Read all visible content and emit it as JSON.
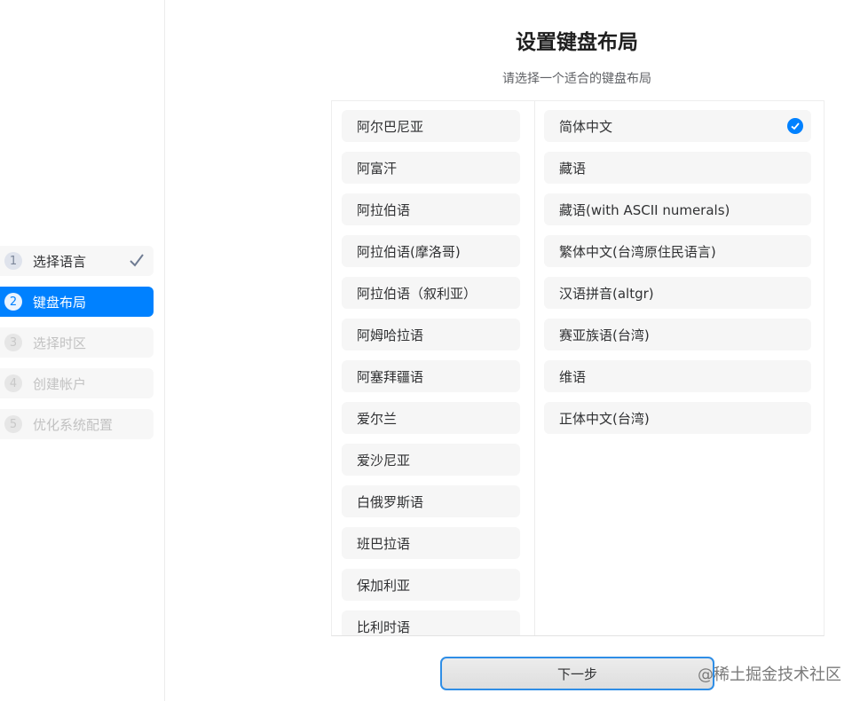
{
  "sidebar": {
    "steps": [
      {
        "num": "1",
        "label": "选择语言",
        "state": "done"
      },
      {
        "num": "2",
        "label": "键盘布局",
        "state": "active"
      },
      {
        "num": "3",
        "label": "选择时区",
        "state": "pending"
      },
      {
        "num": "4",
        "label": "创建帐户",
        "state": "pending"
      },
      {
        "num": "5",
        "label": "优化系统配置",
        "state": "pending"
      }
    ]
  },
  "main": {
    "title": "设置键盘布局",
    "subtitle": "请选择一个适合的键盘布局",
    "layouts": [
      "阿尔巴尼亚",
      "阿富汗",
      "阿拉伯语",
      "阿拉伯语(摩洛哥)",
      "阿拉伯语（叙利亚）",
      "阿姆哈拉语",
      "阿塞拜疆语",
      "爱尔兰",
      "爱沙尼亚",
      "白俄罗斯语",
      "班巴拉语",
      "保加利亚",
      "比利时语"
    ],
    "variants": [
      "简体中文",
      "藏语",
      "藏语(with ASCII numerals)",
      "繁体中文(台湾原住民语言)",
      "汉语拼音(altgr)",
      "赛亚族语(台湾)",
      "维语",
      "正体中文(台湾)"
    ],
    "selected_variant": "简体中文",
    "next_label": "下一步"
  },
  "watermark": "@稀土掘金技术社区",
  "colors": {
    "accent": "#0081ff",
    "item_bg": "#f6f6f6"
  }
}
